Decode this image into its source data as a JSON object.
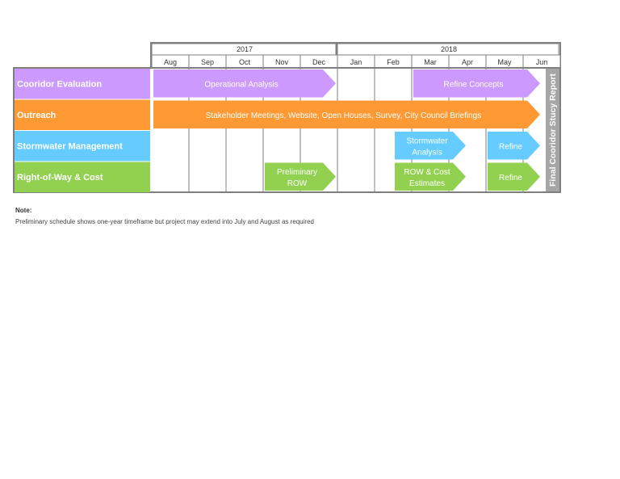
{
  "chart_data": {
    "type": "gantt",
    "title": "",
    "years": [
      {
        "label": "2017",
        "months": [
          "Aug",
          "Sep",
          "Oct",
          "Nov",
          "Dec"
        ]
      },
      {
        "label": "2018",
        "months": [
          "Jan",
          "Feb",
          "Mar",
          "Apr",
          "May",
          "Jun"
        ]
      }
    ],
    "months": [
      "Aug",
      "Sep",
      "Oct",
      "Nov",
      "Dec",
      "Jan",
      "Feb",
      "Mar",
      "Apr",
      "May",
      "Jun"
    ],
    "rows": [
      {
        "label": "Cooridor Evaluation",
        "color": "#cc99ff",
        "tasks": [
          {
            "label": "Operational Analysis",
            "start": 0,
            "end": 5
          },
          {
            "label": "Refine Concepts",
            "start": 7,
            "end": 10.5
          }
        ]
      },
      {
        "label": "Outreach",
        "color": "#ff9933",
        "tasks": [
          {
            "label": "Stakeholder Meetings, Website, Open Houses, Survey, City Council Briefings",
            "start": 0,
            "end": 10.5
          }
        ]
      },
      {
        "label": "Stormwater Management",
        "color": "#66ccff",
        "tasks": [
          {
            "label": "Stormwater Analysis",
            "start": 6.5,
            "end": 8.5
          },
          {
            "label": "Refine",
            "start": 9,
            "end": 10.5
          }
        ]
      },
      {
        "label": "Right-of-Way & Cost",
        "color": "#92d050",
        "tasks": [
          {
            "label": "Preliminary ROW",
            "start": 3,
            "end": 5
          },
          {
            "label": "ROW & Cost Estimates",
            "start": 6.5,
            "end": 8.5
          },
          {
            "label": "Refine",
            "start": 9,
            "end": 10.5
          }
        ]
      }
    ],
    "milestone": {
      "label": "Final Cooridor Stucy Report",
      "month": "Jun",
      "color": "#a6a6a6"
    }
  },
  "note": {
    "title": "Note:",
    "text": "Preliminary schedule shows one-year timeframe but project may extend into July and August as required"
  }
}
